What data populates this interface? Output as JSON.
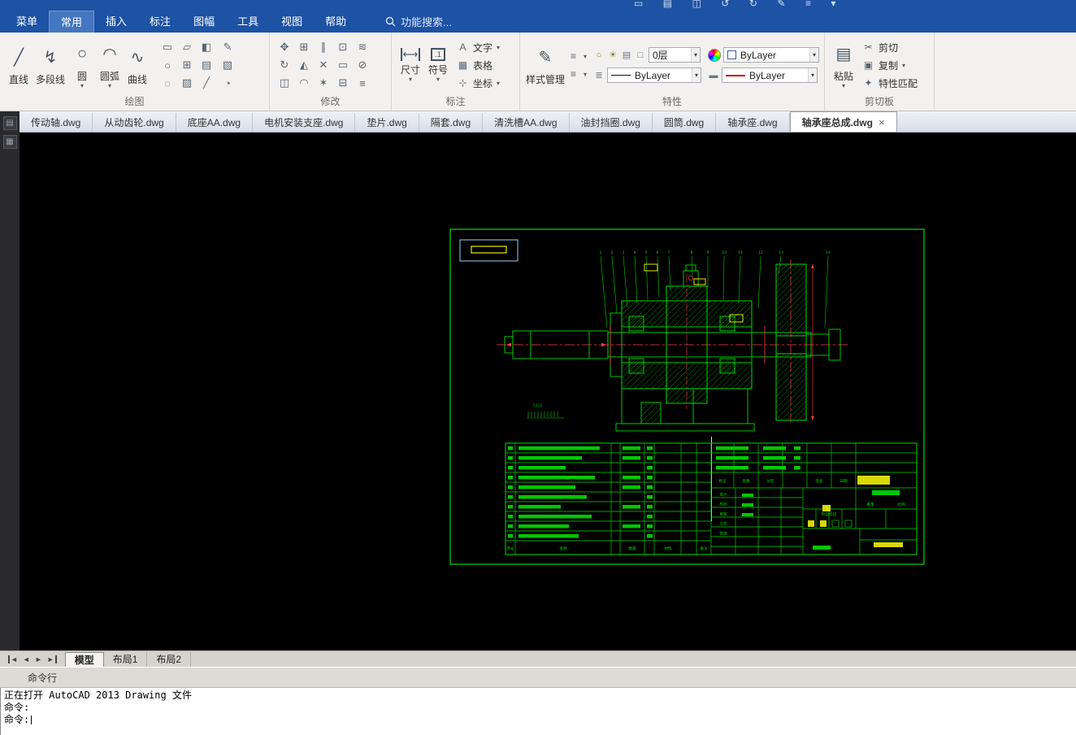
{
  "icons": {
    "caret": "▾",
    "close": "×"
  },
  "quick_access": {
    "icons": [
      "▭",
      "▤",
      "◫",
      "↺",
      "↻",
      "✎",
      "≡",
      "▾"
    ]
  },
  "menubar": {
    "items": [
      "菜单",
      "常用",
      "插入",
      "标注",
      "图幅",
      "工具",
      "视图",
      "帮助"
    ],
    "search_label": "功能搜索..."
  },
  "ribbon": {
    "draw": {
      "label": "绘图",
      "big": [
        {
          "icon": "╱",
          "label": "直线"
        },
        {
          "icon": "↯",
          "label": "多段线"
        },
        {
          "icon": "○",
          "label": "圆"
        },
        {
          "icon": "◠",
          "label": "圆弧"
        },
        {
          "icon": "∿",
          "label": "曲线"
        }
      ],
      "grid": [
        "▭",
        "○",
        "◌",
        "▱",
        "⊞",
        "▨",
        "◧",
        "▤",
        "╱"
      ],
      "col2": [
        "✎",
        "▧",
        "◔"
      ]
    },
    "modify": {
      "label": "修改",
      "grid": [
        "✥",
        "↻",
        "◫",
        "⊞",
        "◭",
        "◠",
        "∥",
        "✕",
        "✶",
        "⊡",
        "▭",
        "⊟",
        "≋",
        "⊘",
        "≡"
      ]
    },
    "dim": {
      "label": "标注",
      "big": [
        {
          "icon": "⟷",
          "label": "尺寸"
        },
        {
          "icon": ".1",
          "label": "符号"
        }
      ],
      "small": [
        {
          "icon": "A",
          "label": "文字"
        },
        {
          "icon": "▦",
          "label": "表格"
        },
        {
          "icon": "⊹",
          "label": "坐标"
        }
      ]
    },
    "props": {
      "label": "特性",
      "style_btn": {
        "icon": "✎",
        "label": "样式管理"
      },
      "extra_icon": "≡",
      "layer_icons": [
        "○",
        "☀",
        "▤",
        "□"
      ],
      "layer_value": "0层",
      "linetype_icon": "≣",
      "linetype_value": "ByLayer",
      "color_value": "ByLayer",
      "lineweight_icon": "▬",
      "lineweight_value": "ByLayer"
    },
    "clip": {
      "label": "剪切板",
      "paste": {
        "icon": "▤",
        "label": "粘贴"
      },
      "items": [
        {
          "icon": "✂",
          "label": "剪切"
        },
        {
          "icon": "▣",
          "label": "复制"
        },
        {
          "icon": "✦",
          "label": "特性匹配"
        }
      ]
    }
  },
  "left_strip": {
    "icons": [
      "▤",
      "▦"
    ]
  },
  "doc_tabs": {
    "close_icon": "×",
    "tabs": [
      {
        "label": "传动轴.dwg"
      },
      {
        "label": "从动齿轮.dwg"
      },
      {
        "label": "底座AA.dwg"
      },
      {
        "label": "电机安装支座.dwg"
      },
      {
        "label": "垫片.dwg"
      },
      {
        "label": "隔套.dwg"
      },
      {
        "label": "清洗槽AA.dwg"
      },
      {
        "label": "油封挡圈.dwg"
      },
      {
        "label": "圆筒.dwg"
      },
      {
        "label": "轴承座.dwg"
      },
      {
        "label": "轴承座总成.dwg"
      }
    ]
  },
  "drawing": {
    "balloons": [
      "1",
      "2",
      "3",
      "4",
      "5",
      "6",
      "7",
      "8",
      "9",
      "10",
      "11",
      "12",
      "13",
      "14"
    ],
    "bom_headers": {
      "no": "序号",
      "name": "名称",
      "qty": "数量",
      "mat": "材料",
      "note": "备注"
    },
    "change_row": {
      "mark": "标记",
      "count": "处数",
      "zone": "分区",
      "sign": "签名",
      "date": "日期"
    },
    "sig_labels": {
      "design": "设计",
      "check": "校对",
      "review": "审核",
      "process": "工艺",
      "approve": "批准"
    },
    "title_cells": {
      "stage": "阶段标记",
      "weight": "重量",
      "scale": "比例"
    }
  },
  "layout_tabs": {
    "nav": [
      "◄",
      "◄",
      "►",
      "►"
    ],
    "tabs": [
      {
        "label": "模型"
      },
      {
        "label": "布局1"
      },
      {
        "label": "布局2"
      }
    ]
  },
  "cmd": {
    "title": "命令行",
    "lines": [
      "正在打开 AutoCAD 2013 Drawing 文件",
      "命令:",
      "命令:"
    ]
  }
}
